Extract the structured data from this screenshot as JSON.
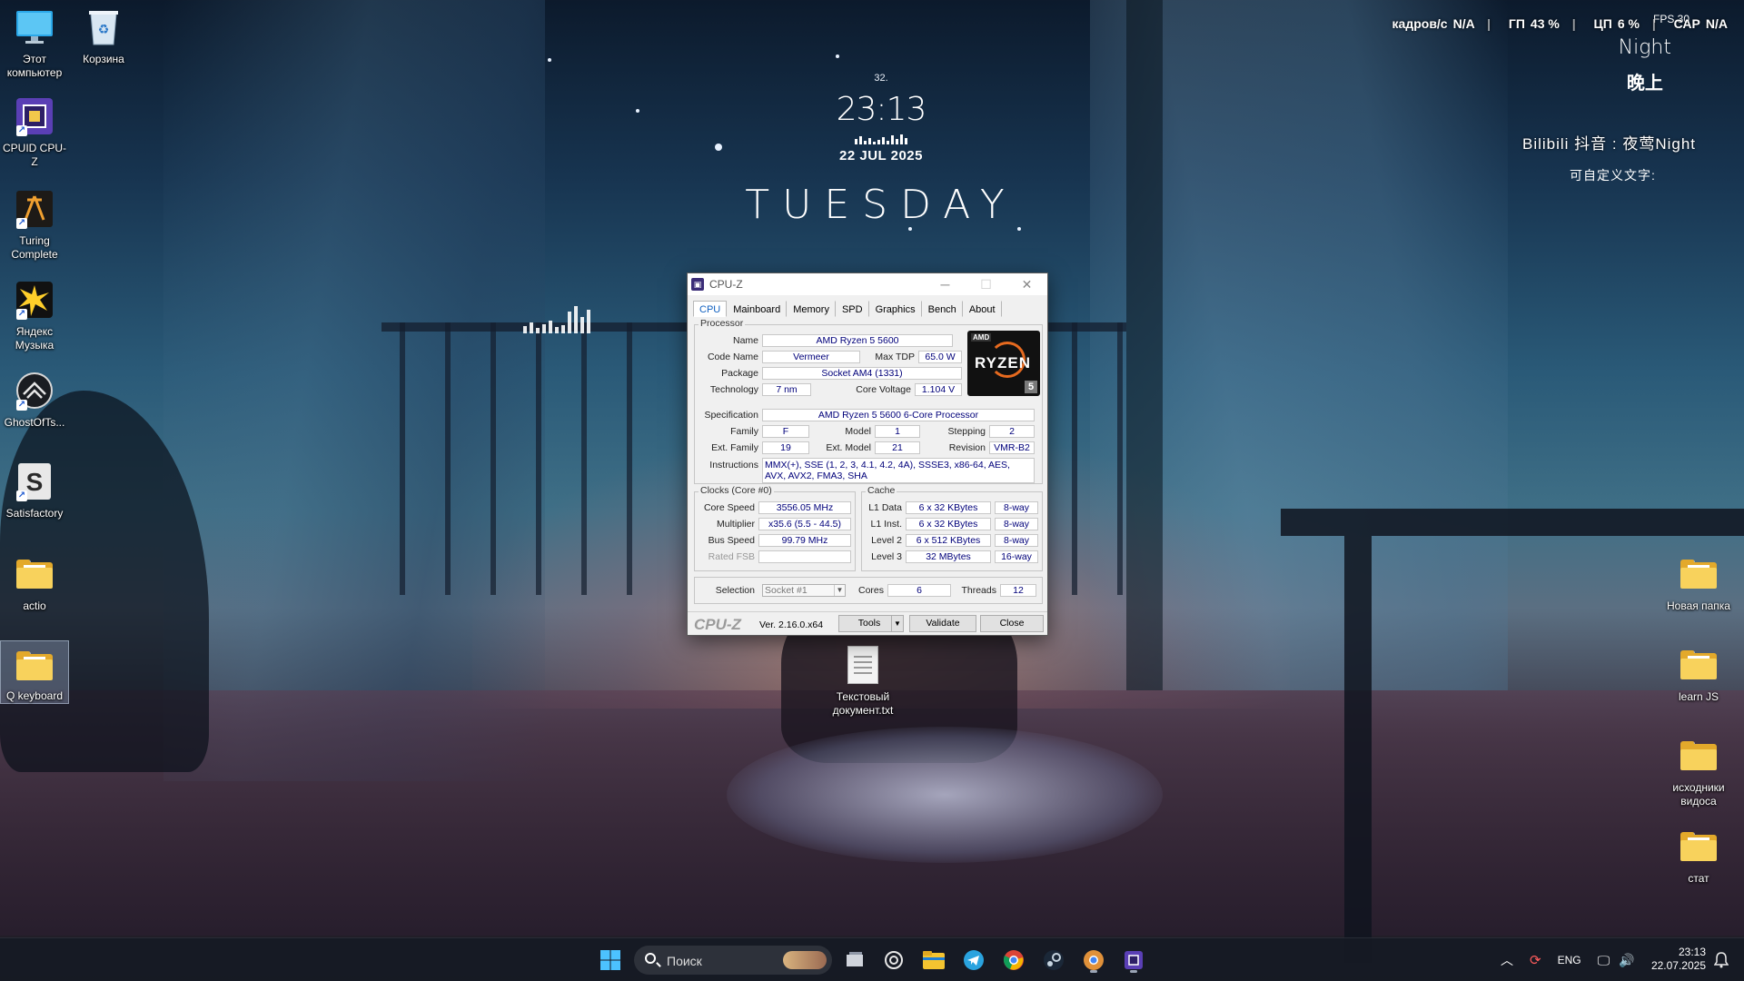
{
  "desktop": {
    "left_icons": [
      {
        "label": "Этот компьютер",
        "icon": "monitor-icon"
      },
      {
        "label": "Корзина",
        "icon": "recycle-bin-icon"
      },
      {
        "label": "CPUID CPU-Z",
        "icon": "cpuz-icon"
      },
      {
        "label": "Turing Complete",
        "icon": "turing-complete-icon"
      },
      {
        "label": "Яндекс Музыка",
        "icon": "yandex-music-icon"
      },
      {
        "label": "GhostOfTs...",
        "icon": "ghost-of-tsushima-icon"
      },
      {
        "label": "Satisfactory",
        "icon": "satisfactory-icon"
      },
      {
        "label": "actio",
        "icon": "folder-icon"
      },
      {
        "label": "Q keyboard",
        "icon": "folder-icon"
      }
    ],
    "right_icons": [
      {
        "label": "Новая папка",
        "icon": "folder-icon"
      },
      {
        "label": "learn JS",
        "icon": "folder-icon"
      },
      {
        "label": "исходники видоса",
        "icon": "folder-icon"
      },
      {
        "label": "стат",
        "icon": "folder-icon"
      }
    ],
    "center_icon": {
      "label": "Текстовый документ.txt",
      "icon": "text-file-icon"
    }
  },
  "overlay": {
    "fps_label": "кадров/с",
    "fps_value": "N/A",
    "gpu_label": "ГП",
    "gpu_value": "43 %",
    "cpu_label": "ЦП",
    "cpu_value": "6 %",
    "cap_label": "САР",
    "cap_value": "N/A",
    "small_fps": "FPS  30"
  },
  "widgets": {
    "night_en": "Night",
    "night_cn": "晚上",
    "social_line": "Bilibili 抖音 : 夜莺Night",
    "custom_text": "可自定义文字:",
    "temperature": "32.",
    "time": "23:13",
    "date": "22 JUL 2025",
    "weekday": "TUESDAY"
  },
  "cpuz": {
    "title": "CPU-Z",
    "tabs": [
      "CPU",
      "Mainboard",
      "Memory",
      "SPD",
      "Graphics",
      "Bench",
      "About"
    ],
    "active_tab": "CPU",
    "processor": {
      "group_label": "Processor",
      "name_label": "Name",
      "name": "AMD Ryzen 5 5600",
      "codename_label": "Code Name",
      "codename": "Vermeer",
      "maxtdp_label": "Max TDP",
      "maxtdp": "65.0 W",
      "package_label": "Package",
      "package": "Socket AM4 (1331)",
      "technology_label": "Technology",
      "technology": "7 nm",
      "corevoltage_label": "Core Voltage",
      "corevoltage": "1.104 V",
      "specification_label": "Specification",
      "specification": "AMD Ryzen 5 5600 6-Core Processor",
      "family_label": "Family",
      "family": "F",
      "model_label": "Model",
      "model": "1",
      "stepping_label": "Stepping",
      "stepping": "2",
      "extfamily_label": "Ext. Family",
      "extfamily": "19",
      "extmodel_label": "Ext. Model",
      "extmodel": "21",
      "revision_label": "Revision",
      "revision": "VMR-B2",
      "instructions_label": "Instructions",
      "instructions": "MMX(+), SSE (1, 2, 3, 4.1, 4.2, 4A), SSSE3, x86-64, AES, AVX, AVX2, FMA3, SHA",
      "logo_brand": "AMD",
      "logo_text": "RYZEN",
      "logo_tier": "5"
    },
    "clocks": {
      "group_label": "Clocks (Core #0)",
      "corespeed_label": "Core Speed",
      "corespeed": "3556.05 MHz",
      "multiplier_label": "Multiplier",
      "multiplier": "x35.6 (5.5 - 44.5)",
      "busspeed_label": "Bus Speed",
      "busspeed": "99.79 MHz",
      "ratedfsb_label": "Rated FSB",
      "ratedfsb": ""
    },
    "cache": {
      "group_label": "Cache",
      "rows": [
        {
          "label": "L1 Data",
          "size": "6 x 32 KBytes",
          "way": "8-way"
        },
        {
          "label": "L1 Inst.",
          "size": "6 x 32 KBytes",
          "way": "8-way"
        },
        {
          "label": "Level 2",
          "size": "6 x 512 KBytes",
          "way": "8-way"
        },
        {
          "label": "Level 3",
          "size": "32 MBytes",
          "way": "16-way"
        }
      ]
    },
    "selection_label": "Selection",
    "selection": "Socket #1",
    "cores_label": "Cores",
    "cores": "6",
    "threads_label": "Threads",
    "threads": "12",
    "footer": {
      "brand": "CPU-Z",
      "version": "Ver. 2.16.0.x64",
      "tools": "Tools",
      "validate": "Validate",
      "close": "Close"
    }
  },
  "taskbar": {
    "search_placeholder": "Поиск",
    "language": "ENG",
    "time": "23:13",
    "date": "22.07.2025",
    "apps": [
      "windows-start-icon",
      "task-view-icon",
      "chatgpt-icon",
      "file-explorer-icon",
      "telegram-icon",
      "chrome-icon",
      "steam-icon",
      "chrome-canary-icon",
      "cpuz-taskbar-icon"
    ]
  }
}
